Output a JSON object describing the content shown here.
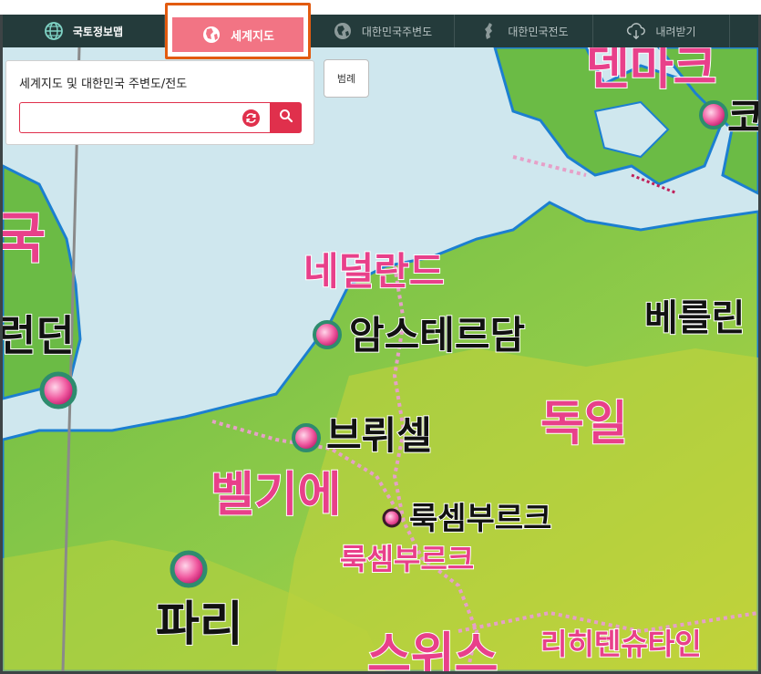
{
  "nav": {
    "items": [
      {
        "label": "국토정보맵",
        "icon": "globe-icon"
      },
      {
        "label": "세계지도",
        "icon": "earth-icon",
        "active": true
      },
      {
        "label": "대한민국주변도",
        "icon": "earth-dark-icon"
      },
      {
        "label": "대한민국전도",
        "icon": "korea-map-icon"
      },
      {
        "label": "내려받기",
        "icon": "cloud-download-icon"
      }
    ]
  },
  "search": {
    "title": "세계지도 및 대한민국 주변도/전도",
    "value": "",
    "placeholder": "",
    "reset_icon": "refresh-icon",
    "submit_icon": "search-icon"
  },
  "legend": {
    "label": "범례"
  },
  "map": {
    "countries": [
      "덴마크",
      "네덜란드",
      "독일",
      "벨기에",
      "룩셈부르크",
      "리히텐슈타인",
      "스위스",
      "영국"
    ],
    "cities": [
      "코",
      "런던",
      "암스테르담",
      "베를린",
      "브뤼셀",
      "룩셈부르크",
      "파리"
    ],
    "partials": {
      "denmark": "덴마크",
      "uk": "국",
      "london": "런던",
      "switzerland": "스위스",
      "copenhagen": "코"
    }
  },
  "colors": {
    "nav_bg": "#243b3b",
    "active_tab": "#f27484",
    "accent": "#e0304c",
    "highlight_border": "#e25b10",
    "sea": "#cfe7ee",
    "land": "#7cc24a",
    "country_label": "#e8408a"
  }
}
